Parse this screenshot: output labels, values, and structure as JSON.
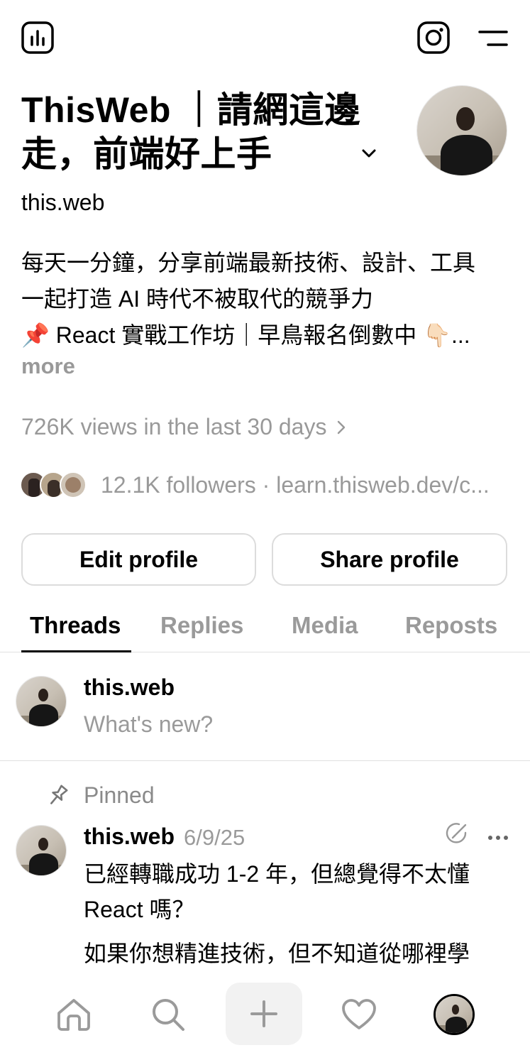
{
  "top_bar": {
    "insights_icon": "bar-chart-square-icon",
    "instagram_icon": "instagram-icon",
    "menu_icon": "menu-icon"
  },
  "profile": {
    "title_line1": "ThisWeb ｜請網這邊",
    "title_line2": "走，前端好上手",
    "username": "this.web",
    "bio_line1": "每天一分鐘，分享前端最新技術、設計、工具",
    "bio_line2": "一起打造 AI 時代不被取代的競爭力",
    "bio_line3": "📌 React 實戰工作坊｜早鳥報名倒數中 👇🏻...",
    "more_label": "more",
    "views_text": "726K views in the last 30 days",
    "followers_text": "12.1K followers · learn.thisweb.dev/c..."
  },
  "actions": {
    "edit_label": "Edit profile",
    "share_label": "Share profile"
  },
  "tabs": [
    {
      "label": "Threads",
      "active": true
    },
    {
      "label": "Replies",
      "active": false
    },
    {
      "label": "Media",
      "active": false
    },
    {
      "label": "Reposts",
      "active": false
    }
  ],
  "composer": {
    "username": "this.web",
    "placeholder": "What's new?"
  },
  "pinned_post": {
    "pinned_label": "Pinned",
    "username": "this.web",
    "date": "6/9/25",
    "text_line1": "已經轉職成功 1-2 年，但總覺得不太懂",
    "text_line2": "React 嗎？",
    "text_line3": "如果你想精進技術，但不知道從哪裡學"
  },
  "bottom_nav": {
    "home_icon": "home-icon",
    "search_icon": "search-icon",
    "create_icon": "plus-icon",
    "activity_icon": "heart-icon",
    "profile_icon": "avatar"
  }
}
